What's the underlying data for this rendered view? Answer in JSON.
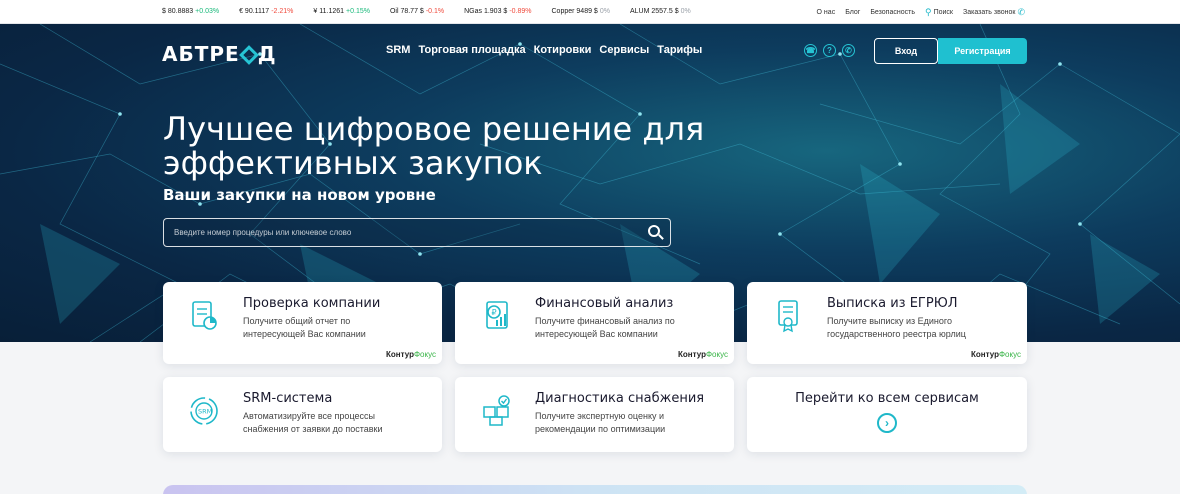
{
  "ticker": [
    {
      "label": "$ 80.8883",
      "change": "+0.03%",
      "dir": "up"
    },
    {
      "label": "€ 90.1117",
      "change": "-2.21%",
      "dir": "down"
    },
    {
      "label": "¥ 11.1261",
      "change": "+0.15%",
      "dir": "up"
    },
    {
      "label": "Oil 78.77 $",
      "change": "-0.1%",
      "dir": "down"
    },
    {
      "label": "NGas 1.903 $",
      "change": "-0.89%",
      "dir": "down"
    },
    {
      "label": "Copper 9489 $",
      "change": "0%",
      "dir": "flat"
    },
    {
      "label": "ALUM 2557.5 $",
      "change": "0%",
      "dir": "flat"
    }
  ],
  "util": {
    "about": "О нас",
    "blog": "Блог",
    "security": "Безопасность",
    "search": "Поиск",
    "callback": "Заказать звонок"
  },
  "header": {
    "logo_left": "АБТРЕ",
    "logo_right": "Д",
    "nav": [
      "SRM",
      "Торговая площадка",
      "Котировки",
      "Сервисы",
      "Тарифы"
    ],
    "login": "Вход",
    "register": "Регистрация"
  },
  "hero": {
    "title": "Лучшее цифровое решение для эффективных закупок",
    "subtitle": "Ваши закупки на новом уровне",
    "search_placeholder": "Введите номер процедуры или ключевое слово"
  },
  "cards": {
    "company": {
      "title": "Проверка компании",
      "desc": "Получите общий отчет по интересующей Вас компании",
      "brand": "Контур",
      "brand2": "Фокус"
    },
    "finance": {
      "title": "Финансовый анализ",
      "desc": "Получите финансовый анализ по интересующей Вас компании",
      "brand": "Контур",
      "brand2": "Фокус"
    },
    "egrul": {
      "title": "Выписка из ЕГРЮЛ",
      "desc": "Получите выписку из Единого государственного реестра юрлиц",
      "brand": "Контур",
      "brand2": "Фокус"
    },
    "srm": {
      "title": "SRM-система",
      "desc": "Автоматизируйте все процессы снабжения от заявки до поставки",
      "icon_text": "SRM"
    },
    "diag": {
      "title": "Диагностика снабжения",
      "desc": "Получите экспертную оценку и рекомендации по оптимизации"
    },
    "all": {
      "title": "Перейти ко всем сервисам"
    }
  },
  "colors": {
    "accent": "#1fc0d0",
    "hero_dark": "#0a2745",
    "up": "#18b97a",
    "down": "#f04a3c"
  }
}
